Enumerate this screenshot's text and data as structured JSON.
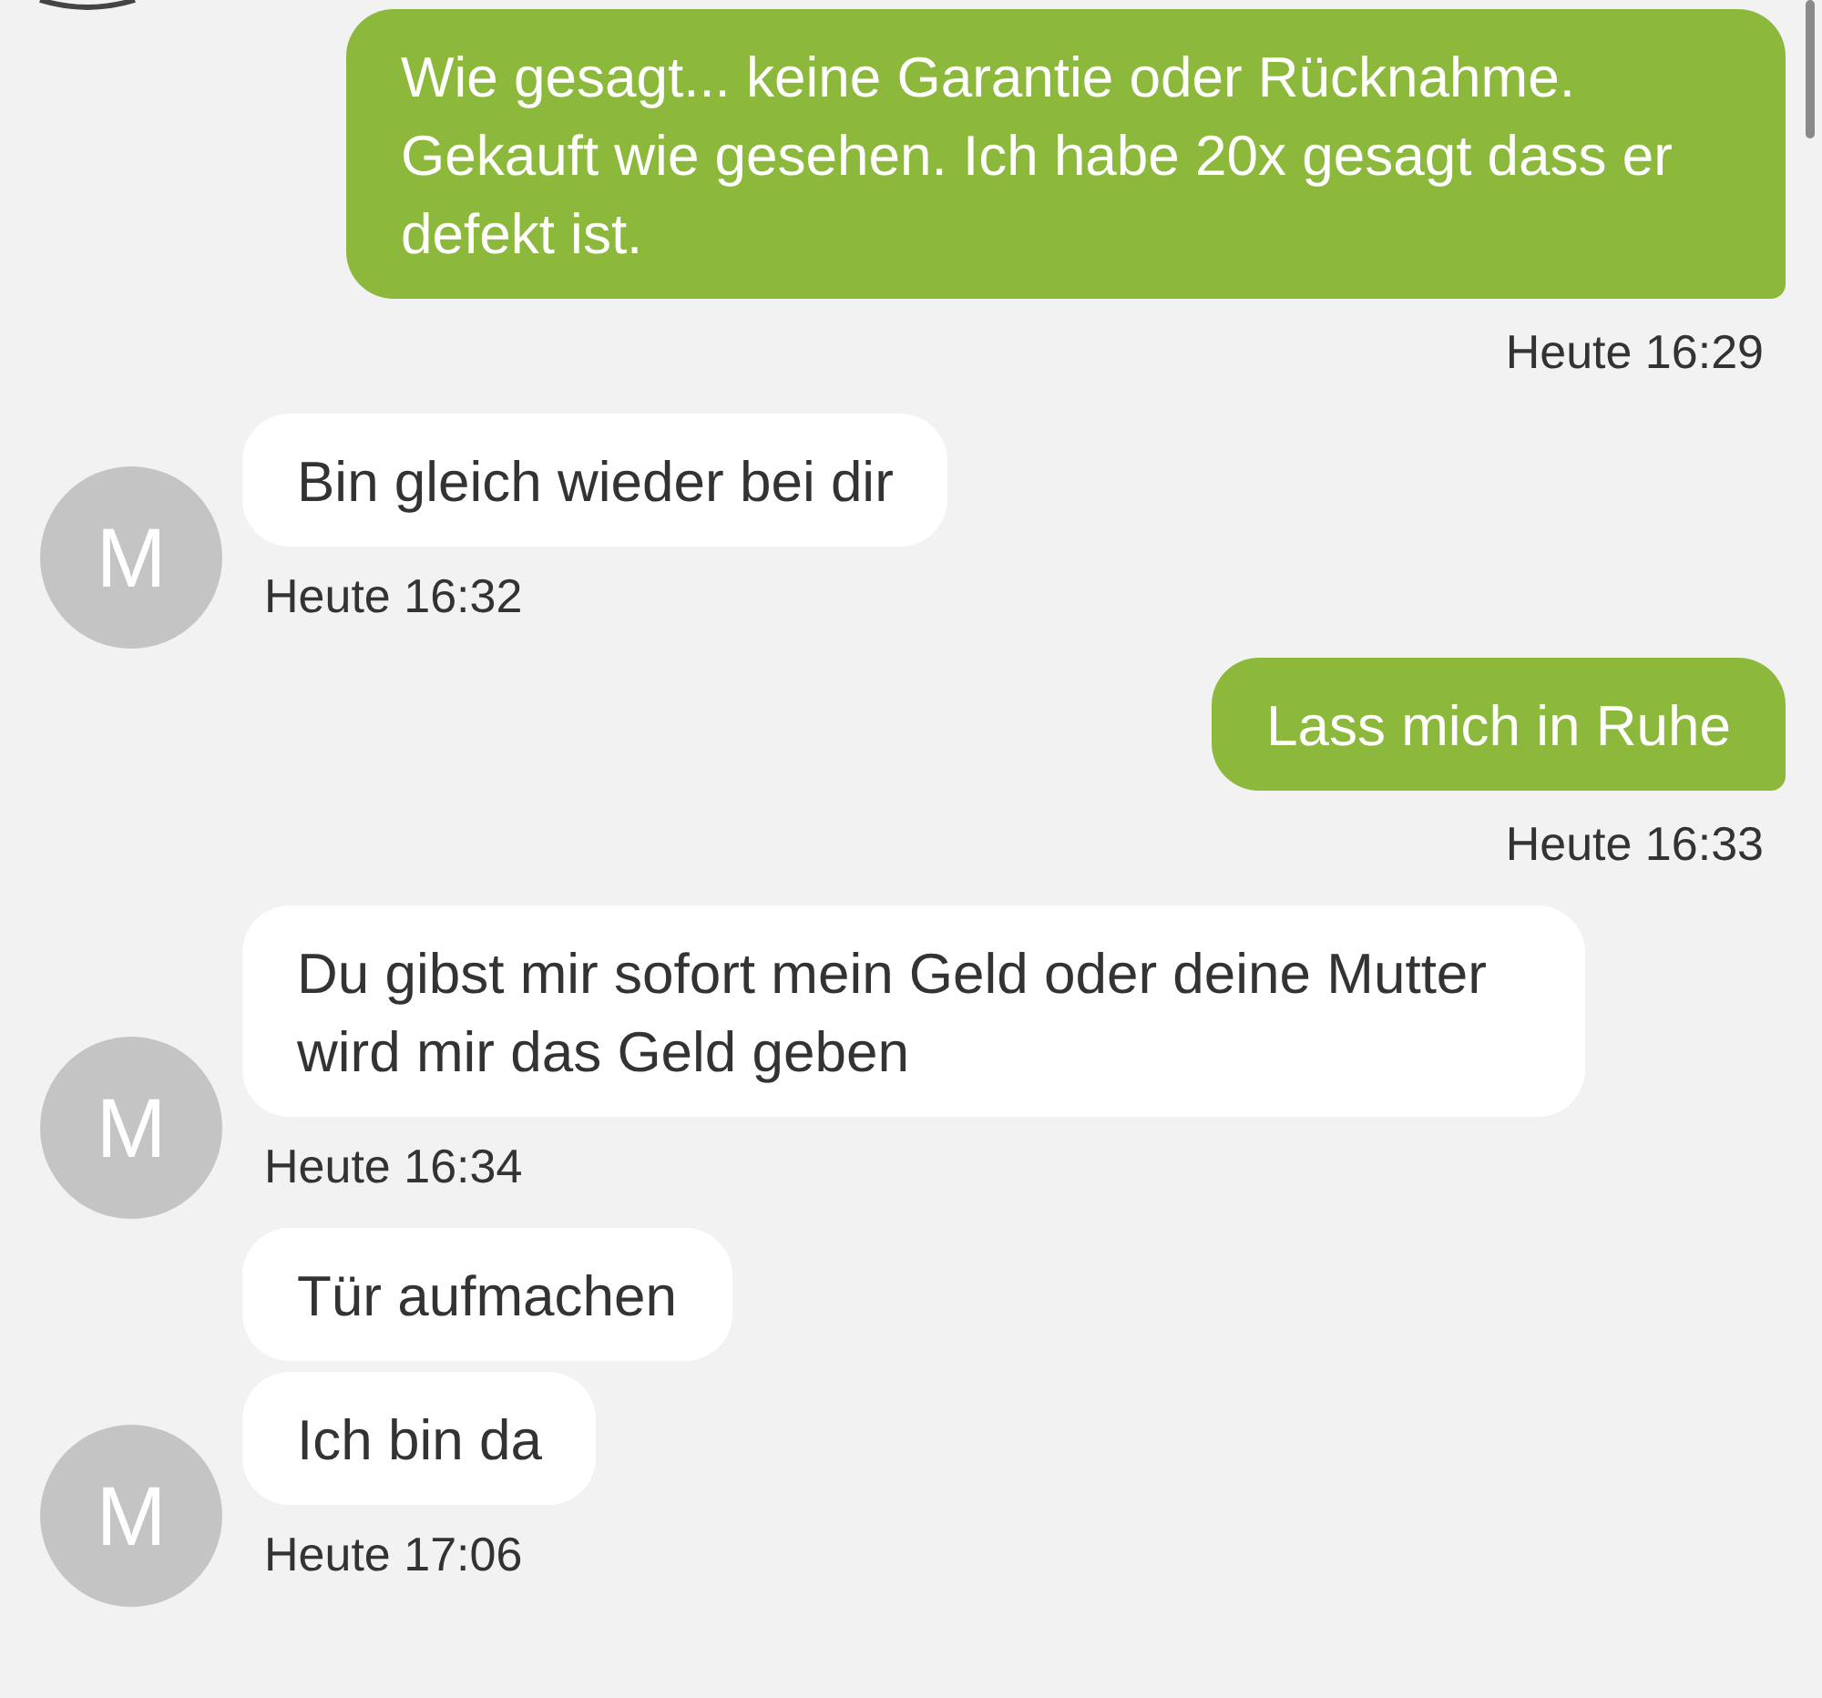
{
  "messages": [
    {
      "kind": "outgoing",
      "bubbles": [
        "Wie gesagt... keine Garantie oder Rücknahme. Gekauft wie gesehen. Ich habe 20x gesagt dass er defekt ist."
      ],
      "time": "Heute 16:29"
    },
    {
      "kind": "incoming",
      "avatar": "M",
      "bubbles": [
        "Bin gleich wieder bei dir"
      ],
      "time": "Heute 16:32"
    },
    {
      "kind": "outgoing",
      "bubbles": [
        "Lass mich in Ruhe"
      ],
      "time": "Heute 16:33"
    },
    {
      "kind": "incoming",
      "avatar": "M",
      "bubbles": [
        "Du gibst mir sofort mein Geld oder deine Mutter wird mir das Geld geben"
      ],
      "time": "Heute 16:34"
    },
    {
      "kind": "incoming",
      "avatar": "M",
      "bubbles": [
        "Tür aufmachen",
        "Ich bin da"
      ],
      "time": "Heute 17:06"
    }
  ]
}
